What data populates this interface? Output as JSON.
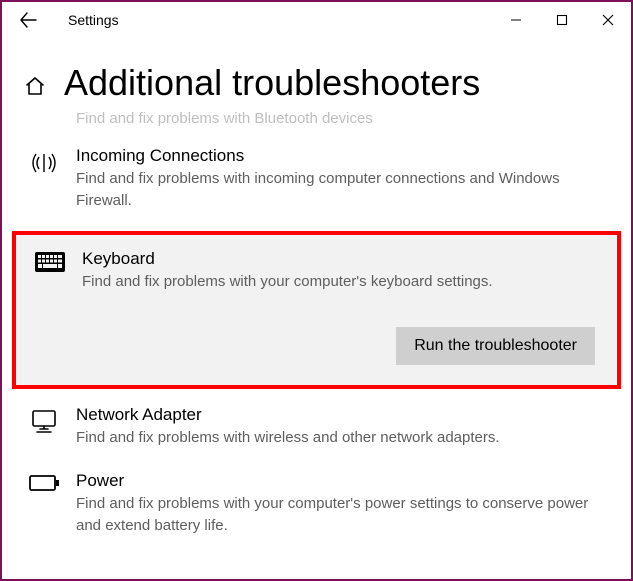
{
  "titlebar": {
    "title": "Settings"
  },
  "page": {
    "title": "Additional troubleshooters"
  },
  "items": {
    "cutoff": {
      "desc": "Find and fix problems with Bluetooth devices"
    },
    "incoming": {
      "title": "Incoming Connections",
      "desc": "Find and fix problems with incoming computer connections and Windows Firewall."
    },
    "keyboard": {
      "title": "Keyboard",
      "desc": "Find and fix problems with your computer's keyboard settings.",
      "run": "Run the troubleshooter"
    },
    "network": {
      "title": "Network Adapter",
      "desc": "Find and fix problems with wireless and other network adapters."
    },
    "power": {
      "title": "Power",
      "desc": "Find and fix problems with your computer's power settings to conserve power and extend battery life."
    }
  }
}
